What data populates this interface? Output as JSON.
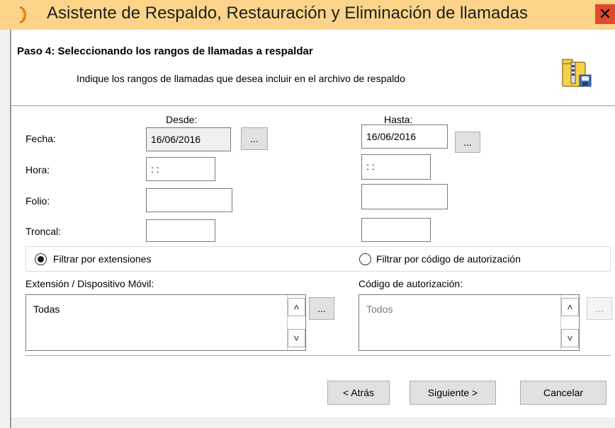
{
  "window": {
    "title": "Asistente de Respaldo, Restauración y Eliminación de llamadas",
    "close_glyph": "✕"
  },
  "header": {
    "step_title": "Paso 4: Seleccionando los rangos de llamadas a respaldar",
    "step_description": "Indique los rangos de llamadas que desea incluir en el archivo de respaldo",
    "icon": "backup-archive-icon"
  },
  "range": {
    "from_label": "Desde:",
    "to_label": "Hasta:",
    "rows": {
      "fecha": {
        "label": "Fecha:",
        "from": "16/06/2016",
        "to": "16/06/2016"
      },
      "hora": {
        "label": "Hora:",
        "from": " :  :",
        "to": " :  :"
      },
      "folio": {
        "label": "Folio:",
        "from": "",
        "to": ""
      },
      "troncal": {
        "label": "Troncal:",
        "from": "",
        "to": ""
      }
    },
    "picker_label": "..."
  },
  "filter": {
    "by_extensions_label": "Filtrar por extensiones",
    "by_extensions_selected": true,
    "by_auth_code_label": "Filtrar por código de autorización",
    "by_auth_code_selected": false
  },
  "extensions": {
    "label": "Extensión / Dispositivo Móvil:",
    "value": "Todas",
    "picker_label": "..."
  },
  "auth_codes": {
    "label": "Código de autorización:",
    "value": "Todos",
    "picker_label": "..."
  },
  "scroll": {
    "up_glyph": "˄",
    "down_glyph": "˅"
  },
  "buttons": {
    "back": "< Atrás",
    "next": "Siguiente >",
    "cancel": "Cancelar"
  },
  "colors": {
    "titlebar": "#fbd48a",
    "close": "#e0492f",
    "panel": "#ffffff"
  }
}
